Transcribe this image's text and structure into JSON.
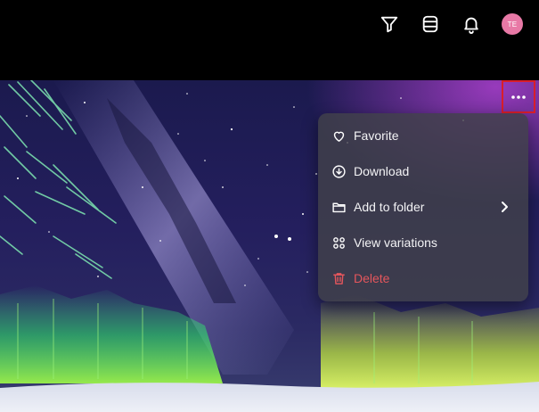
{
  "header": {
    "icons": [
      "filter-icon",
      "database-icon",
      "bell-icon"
    ],
    "avatar_initials": "TE",
    "avatar_color": "#e879a6"
  },
  "image_actions": {
    "more_button_icon": "more-horizontal-icon",
    "highlight_color": "#d91e2a"
  },
  "menu": {
    "items": [
      {
        "label": "Favorite",
        "icon": "heart-icon"
      },
      {
        "label": "Download",
        "icon": "download-icon"
      },
      {
        "label": "Add to folder",
        "icon": "folder-icon",
        "submenu": true
      },
      {
        "label": "View variations",
        "icon": "grid-icon"
      },
      {
        "label": "Delete",
        "icon": "trash-icon",
        "danger_color": "#e4565c"
      }
    ]
  }
}
